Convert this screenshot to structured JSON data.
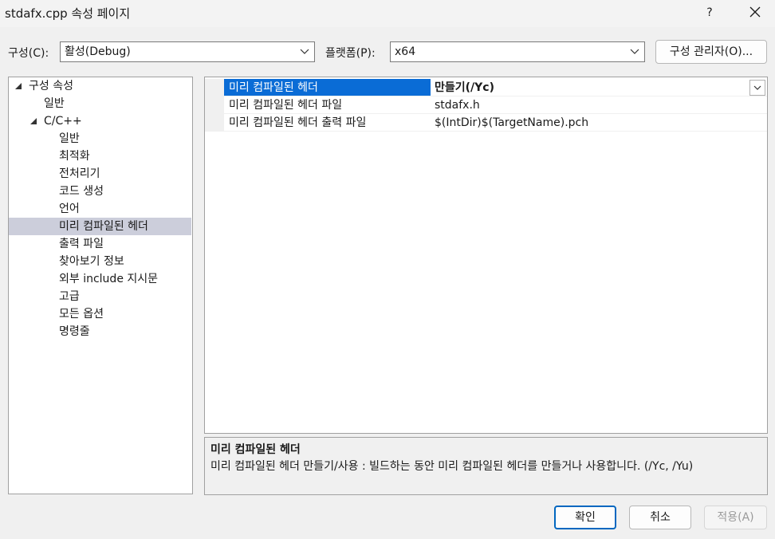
{
  "window": {
    "title": "stdafx.cpp 속성 페이지",
    "help_label": "?"
  },
  "toolbar": {
    "config_label": "구성(C):",
    "config_value": "활성(Debug)",
    "platform_label": "플랫폼(P):",
    "platform_value": "x64",
    "config_manager_label": "구성 관리자(O)..."
  },
  "tree": {
    "items": [
      {
        "label": "구성 속성"
      },
      {
        "label": "일반"
      },
      {
        "label": "C/C++"
      },
      {
        "label": "일반"
      },
      {
        "label": "최적화"
      },
      {
        "label": "전처리기"
      },
      {
        "label": "코드 생성"
      },
      {
        "label": "언어"
      },
      {
        "label": "미리 컴파일된 헤더"
      },
      {
        "label": "출력 파일"
      },
      {
        "label": "찾아보기 정보"
      },
      {
        "label": "외부 include 지시문"
      },
      {
        "label": "고급"
      },
      {
        "label": "모든 옵션"
      },
      {
        "label": "명령줄"
      }
    ]
  },
  "grid": {
    "rows": [
      {
        "name": "미리 컴파일된 헤더",
        "value": "만들기(/Yc)"
      },
      {
        "name": "미리 컴파일된 헤더 파일",
        "value": "stdafx.h"
      },
      {
        "name": "미리 컴파일된 헤더 출력 파일",
        "value": "$(IntDir)$(TargetName).pch"
      }
    ]
  },
  "description": {
    "title": "미리 컴파일된 헤더",
    "text": "미리 컴파일된 헤더 만들기/사용 : 빌드하는 동안 미리 컴파일된 헤더를 만들거나 사용합니다.      (/Yc, /Yu)"
  },
  "buttons": {
    "ok": "확인",
    "cancel": "취소",
    "apply": "적용(A)"
  },
  "colors": {
    "selection_accent": "#0a6cd6",
    "tree_selection": "#cccedb",
    "ok_border": "#0067c0"
  }
}
